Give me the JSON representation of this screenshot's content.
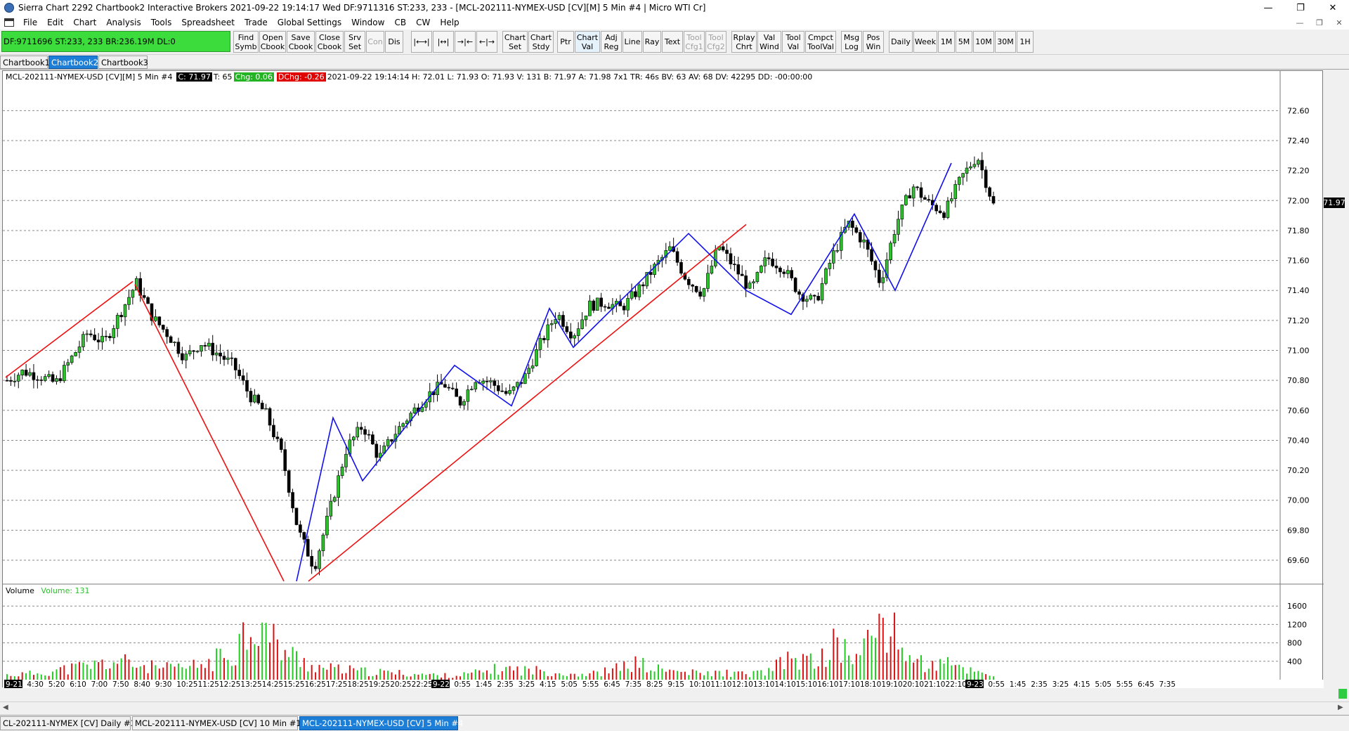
{
  "window": {
    "title": "Sierra Chart 2292 Chartbook2  Interactive Brokers 2021-09-22  19:14:17 Wed  DF:9711316  ST:233, 233 - [MCL-202111-NYMEX-USD [CV][M]  5 Min  #4 | Micro WTI Cr]",
    "controls": [
      "—",
      "❐",
      "✕"
    ]
  },
  "menu": {
    "items": [
      "File",
      "Edit",
      "Chart",
      "Analysis",
      "Tools",
      "Spreadsheet",
      "Trade",
      "Global Settings",
      "Window",
      "CB",
      "CW",
      "Help"
    ],
    "mdi_controls": [
      "—",
      "❐",
      "✕"
    ]
  },
  "toolbar": {
    "status_text": "DF:9711696  ST:233, 233   BR:236.19M  DL:0",
    "buttons": [
      {
        "label": "Find\nSymb",
        "state": "normal"
      },
      {
        "label": "Open\nCbook",
        "state": "normal"
      },
      {
        "label": "Save\nCbook",
        "state": "normal"
      },
      {
        "label": "Close\nCbook",
        "state": "normal"
      },
      {
        "label": "Srv\nSet",
        "state": "normal"
      },
      {
        "label": "Con",
        "state": "disabled"
      },
      {
        "label": "Dis",
        "state": "normal"
      },
      {
        "label": "|⟷|",
        "state": "normal"
      },
      {
        "label": "|↔|",
        "state": "normal"
      },
      {
        "label": "→|←",
        "state": "normal"
      },
      {
        "label": "←|→",
        "state": "normal"
      },
      {
        "label": "Chart\nSet",
        "state": "normal"
      },
      {
        "label": "Chart\nStdy",
        "state": "normal"
      },
      {
        "label": "Ptr",
        "state": "normal"
      },
      {
        "label": "Chart\nVal",
        "state": "active"
      },
      {
        "label": "Adj\nReg",
        "state": "normal"
      },
      {
        "label": "Line",
        "state": "normal"
      },
      {
        "label": "Ray",
        "state": "normal"
      },
      {
        "label": "Text",
        "state": "normal"
      },
      {
        "label": "Tool\nCfg1",
        "state": "disabled"
      },
      {
        "label": "Tool\nCfg2",
        "state": "disabled"
      },
      {
        "label": "Rplay\nChrt",
        "state": "normal"
      },
      {
        "label": "Val\nWind",
        "state": "normal"
      },
      {
        "label": "Tool\nVal",
        "state": "normal"
      },
      {
        "label": "Cmpct\nToolVal",
        "state": "normal"
      },
      {
        "label": "Msg\nLog",
        "state": "normal"
      },
      {
        "label": "Pos\nWin",
        "state": "normal"
      },
      {
        "label": "Daily",
        "state": "normal"
      },
      {
        "label": "Week",
        "state": "normal"
      },
      {
        "label": "1M",
        "state": "normal"
      },
      {
        "label": "5M",
        "state": "normal"
      },
      {
        "label": "10M",
        "state": "normal"
      },
      {
        "label": "30M",
        "state": "normal"
      },
      {
        "label": "1H",
        "state": "normal"
      }
    ]
  },
  "chartbook_tabs": [
    {
      "label": "Chartbook1",
      "selected": false
    },
    {
      "label": "Chartbook2",
      "selected": true
    },
    {
      "label": "Chartbook3",
      "selected": false
    }
  ],
  "chart_header": {
    "symbol": "MCL-202111-NYMEX-USD [CV][M]  5 Min  #4",
    "close": "C: 71.97",
    "trades": "T: 65",
    "change": "Chg: 0.06",
    "daily_change": "DChg: -0.26",
    "details": "2021-09-22 19:14:14 H: 72.01  L: 71.93  O: 71.93  V: 131  B: 71.97  A: 71.98  7x1  TR: 46s  BV: 63  AV: 68  DV: 42295  DD: -00:00:00"
  },
  "volume_header": {
    "label": "Volume",
    "value": "Volume: 131"
  },
  "price_tag": "71.97",
  "chart_data": {
    "type": "candlestick",
    "symbol": "MCL-202111-NYMEX-USD",
    "timeframe": "5 Min",
    "price_axis": {
      "ylim": [
        69.45,
        72.78
      ],
      "ticks": [
        "72.60",
        "72.40",
        "72.20",
        "72.00",
        "71.80",
        "71.60",
        "71.40",
        "71.20",
        "71.00",
        "70.80",
        "70.60",
        "70.40",
        "70.20",
        "70.00",
        "69.80",
        "69.60"
      ]
    },
    "volume_axis": {
      "ylim": [
        0,
        2000
      ],
      "ticks": [
        "1600",
        "1200",
        "800",
        "400"
      ]
    },
    "time_axis": {
      "labels": [
        "9-21",
        "4:30",
        "5:20",
        "6:10",
        "7:00",
        "7:50",
        "8:40",
        "9:30",
        "10:25",
        "11:25",
        "12:25",
        "13:25",
        "14:25",
        "15:25",
        "16:25",
        "17:25",
        "18:25",
        "19:25",
        "20:25",
        "22:25",
        "9-22",
        "0:55",
        "1:45",
        "2:35",
        "3:25",
        "4:15",
        "5:05",
        "5:55",
        "6:45",
        "7:35",
        "8:25",
        "9:15",
        "10:10",
        "11:10",
        "12:10",
        "13:10",
        "14:10",
        "15:10",
        "16:10",
        "17:10",
        "18:10",
        "19:10",
        "20:10",
        "21:10",
        "22:10",
        "9-23",
        "0:55",
        "1:45",
        "2:35",
        "3:25",
        "4:15",
        "5:05",
        "5:55",
        "6:45",
        "7:35"
      ],
      "date_markers": [
        "9-21",
        "9-22",
        "9-23"
      ]
    },
    "price_path": [
      70.8,
      70.86,
      70.83,
      70.78,
      70.95,
      71.12,
      71.05,
      71.25,
      71.45,
      71.22,
      71.1,
      70.95,
      71.05,
      70.98,
      70.9,
      70.7,
      70.58,
      70.3,
      69.8,
      69.55,
      69.95,
      70.35,
      70.5,
      70.28,
      70.45,
      70.58,
      70.7,
      70.78,
      70.65,
      70.82,
      70.78,
      70.7,
      70.82,
      71.05,
      71.25,
      71.1,
      71.3,
      71.32,
      71.28,
      71.4,
      71.55,
      71.68,
      71.48,
      71.38,
      71.7,
      71.55,
      71.4,
      71.62,
      71.55,
      71.38,
      71.32,
      71.62,
      71.85,
      71.72,
      71.45,
      71.85,
      72.1,
      71.98,
      71.92,
      72.15,
      72.3,
      71.97
    ],
    "volume_path": [
      120,
      150,
      220,
      300,
      380,
      460,
      350,
      280,
      300,
      420,
      700,
      1560,
      900,
      500,
      300,
      250,
      200,
      180,
      150,
      120,
      100,
      180,
      280,
      250,
      220,
      160,
      140,
      240,
      420,
      260,
      200,
      150,
      180,
      130,
      220,
      560,
      420,
      900,
      520,
      1600,
      720,
      350,
      380,
      240,
      130
    ],
    "drawn_lines": [
      {
        "color": "red",
        "from": [
          "9-21 4:10",
          70.82
        ],
        "to": [
          "8:30",
          71.46
        ]
      },
      {
        "color": "red",
        "from": [
          "8:35",
          71.44
        ],
        "to": [
          "14:20",
          69.46
        ]
      },
      {
        "color": "red",
        "from": [
          "14:45",
          69.46
        ],
        "to": [
          "8:40",
          71.84
        ]
      },
      {
        "color": "blue",
        "path": [
          [
            "14:35",
            69.46
          ],
          [
            "15:15",
            70.55
          ],
          [
            "17:00",
            70.13
          ],
          [
            "20:15",
            70.9
          ],
          [
            "22:05",
            70.63
          ],
          [
            "1:15",
            71.28
          ],
          [
            "2:00",
            71.02
          ],
          [
            "6:25",
            71.78
          ],
          [
            "9:00",
            71.4
          ],
          [
            "10:50",
            71.24
          ],
          [
            "13:00",
            71.91
          ],
          [
            "14:50",
            71.4
          ],
          [
            "16:15",
            72.25
          ]
        ]
      }
    ]
  },
  "instrument_tabs": [
    {
      "label": "CL-202111-NYMEX [CV]  Daily  #3",
      "selected": false
    },
    {
      "label": "MCL-202111-NYMEX-USD [CV]  10 Min  #1",
      "selected": false
    },
    {
      "label": "MCL-202111-NYMEX-USD [CV]  5 Min  #4",
      "selected": true
    }
  ],
  "colors": {
    "up_volume": "#22cc22",
    "down_volume": "#dd1111",
    "red_line": "#ee1111",
    "blue_line": "#1010ee",
    "status_green": "#3cdc3c",
    "tab_selected": "#1c7ed6"
  }
}
